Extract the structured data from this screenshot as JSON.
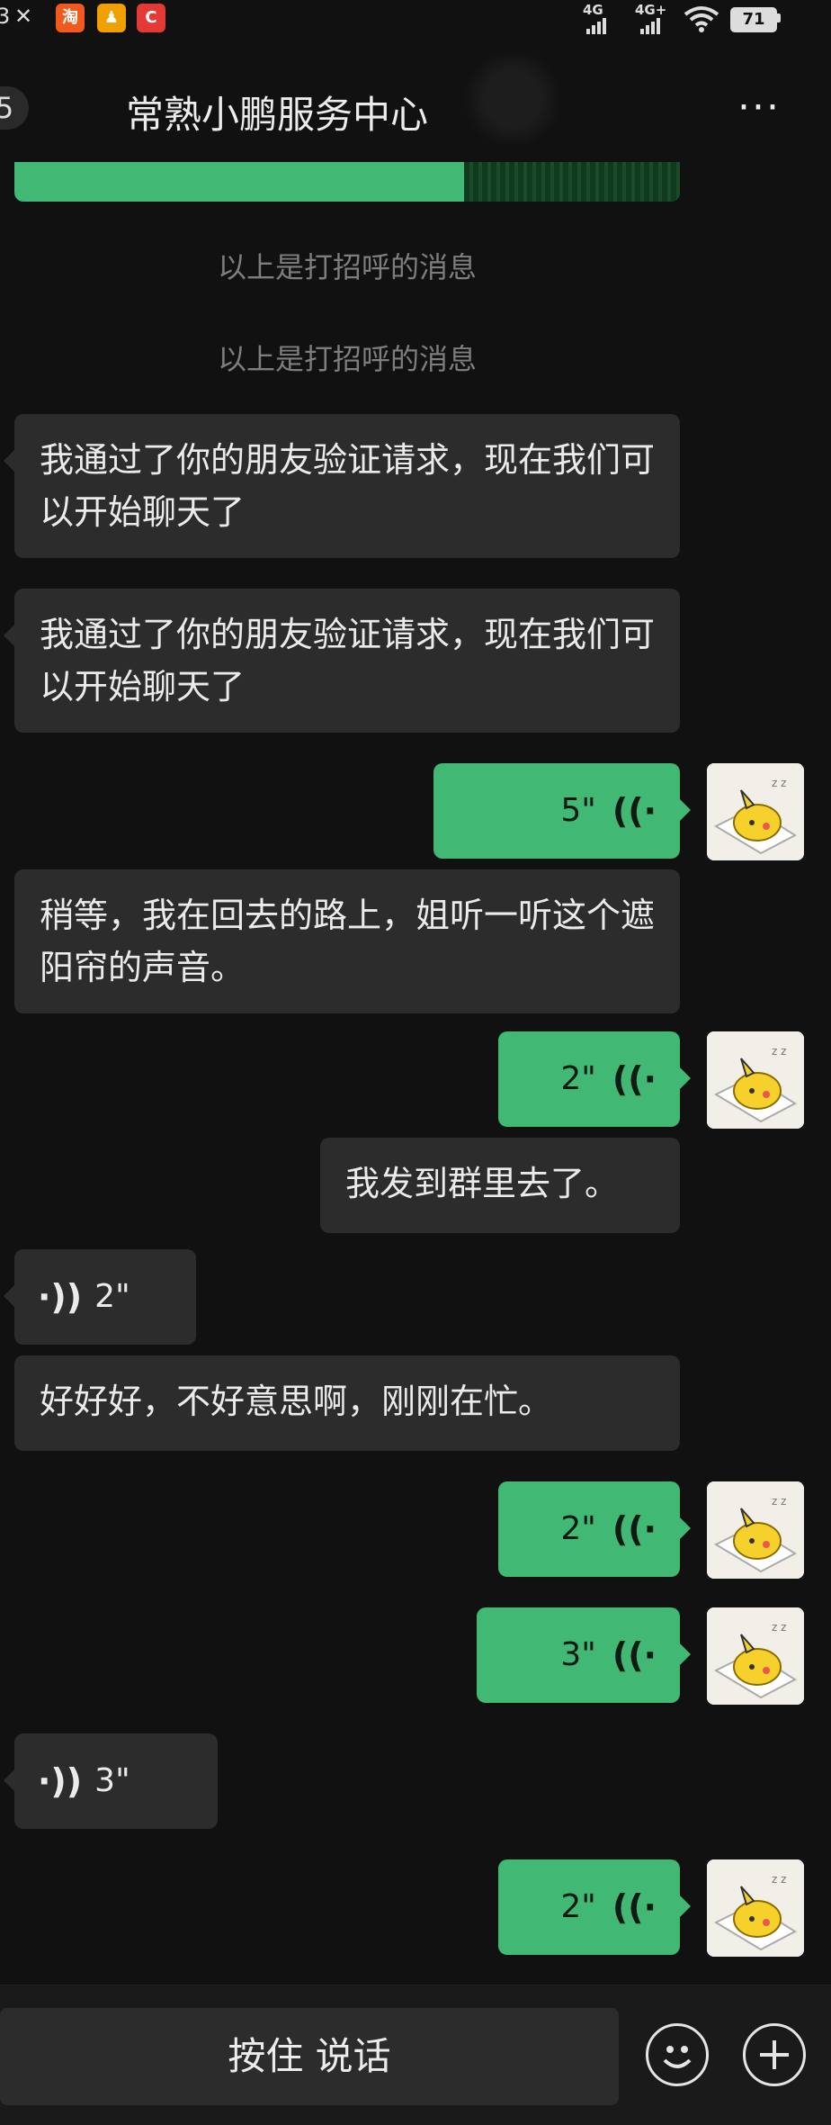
{
  "status_bar": {
    "left_glyphs": [
      "3",
      "✕"
    ],
    "apps": [
      {
        "name": "taobao-app-icon",
        "label": "淘",
        "color": "#f25a1d"
      },
      {
        "name": "user-app-icon",
        "label": "♟",
        "color": "#f0a100"
      },
      {
        "name": "camera-app-icon",
        "label": "C",
        "color": "#e53935"
      }
    ],
    "network_1": "4G",
    "network_2": "4G+",
    "battery": "71"
  },
  "header": {
    "unread_count": "5",
    "title": "常熟小鹏服务中心",
    "more_label": "···"
  },
  "messages": {
    "sys_1": "以上是打招呼的消息",
    "sys_2": "以上是打招呼的消息",
    "in_1": "我通过了你的朋友验证请求，现在我们可以开始聊天了",
    "in_2": "我通过了你的朋友验证请求，现在我们可以开始聊天了",
    "out_voice_1": "5\"",
    "in_3": "稍等，我在回去的路上，姐听一听这个遮阳帘的声音。",
    "out_voice_2": "2\"",
    "out_text_1": "我发到群里去了。",
    "in_voice_1": "2\"",
    "in_4": "好好好，不好意思啊，刚刚在忙。",
    "out_voice_3": "2\"",
    "out_voice_4": "3\"",
    "in_voice_2": "3\"",
    "out_voice_5": "2\""
  },
  "input_bar": {
    "hold_to_talk": "按住 说话"
  },
  "colors": {
    "outgoing_bubble": "#41b874",
    "incoming_bubble": "#2c2c2c",
    "background": "#111111"
  }
}
